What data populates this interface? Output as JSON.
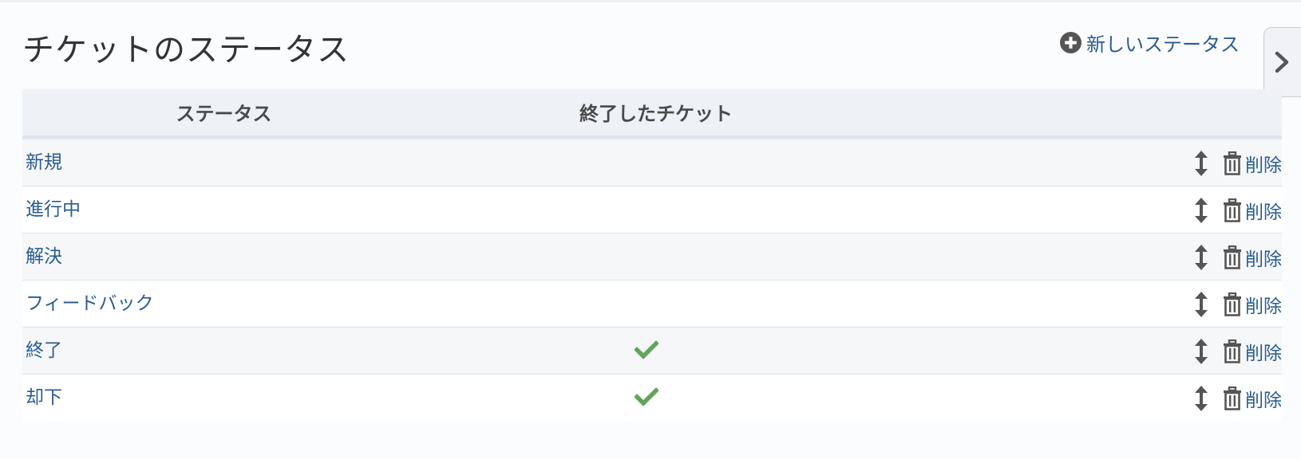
{
  "page": {
    "title": "チケットのステータス",
    "new_status_label": "新しいステータス"
  },
  "table": {
    "columns": [
      "ステータス",
      "終了したチケット",
      ""
    ],
    "rows": [
      {
        "name": "新規",
        "is_closed": false,
        "delete_label": "削除"
      },
      {
        "name": "進行中",
        "is_closed": false,
        "delete_label": "削除"
      },
      {
        "name": "解決",
        "is_closed": false,
        "delete_label": "削除"
      },
      {
        "name": "フィードバック",
        "is_closed": false,
        "delete_label": "削除"
      },
      {
        "name": "終了",
        "is_closed": true,
        "delete_label": "削除"
      },
      {
        "name": "却下",
        "is_closed": true,
        "delete_label": "削除"
      }
    ]
  },
  "icons": {
    "new_status": "plus-circle-icon",
    "sidebar_toggle": "chevron-right-icon",
    "closed": "check-icon",
    "sort": "sort-handle-icon",
    "delete": "trash-icon"
  },
  "colors": {
    "link": "#2a5d8f",
    "check": "#62a55a",
    "icon_gray": "#555555"
  }
}
